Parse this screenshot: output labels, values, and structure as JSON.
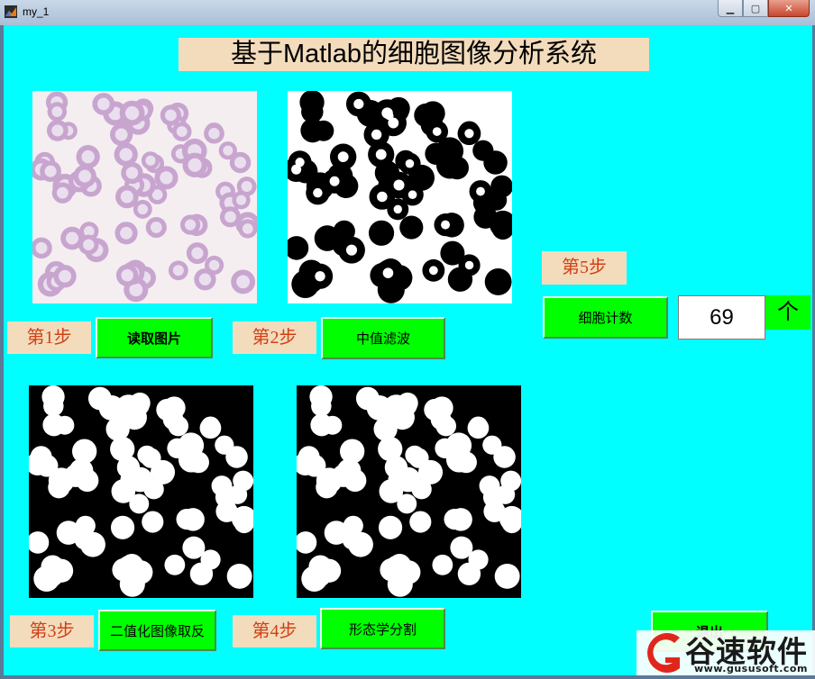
{
  "window": {
    "title": "my_1",
    "minimize": "▭",
    "maximize": "□",
    "close": "✕"
  },
  "main_title": "基于Matlab的细胞图像分析系统",
  "steps": {
    "step1": {
      "label": "第1步",
      "button": "读取图片"
    },
    "step2": {
      "label": "第2步",
      "button": "中值滤波"
    },
    "step3": {
      "label": "第3步",
      "button": "二值化图像取反"
    },
    "step4": {
      "label": "第4步",
      "button": "形态学分割"
    },
    "step5": {
      "label": "第5步",
      "button": "细胞计数"
    }
  },
  "count": {
    "value": "69",
    "unit": "个"
  },
  "exit_button": "退出",
  "watermark": {
    "brand": "谷速软件",
    "url": "www.gususoft.com"
  },
  "colors": {
    "background": "#00ffff",
    "button": "#00ff00",
    "label_bg": "#f3dcbc",
    "step_text": "#d04016"
  }
}
